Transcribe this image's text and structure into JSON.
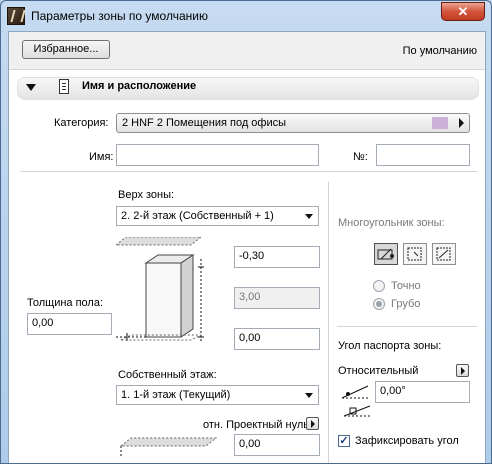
{
  "window": {
    "title": "Параметры зоны по умолчанию",
    "close_label": "✕"
  },
  "topbar": {
    "favorites_label": "Избранное...",
    "default_label": "По умолчанию"
  },
  "section": {
    "title": "Имя и расположение"
  },
  "form": {
    "category_label": "Категория:",
    "category_value": "2 HNF   2 Помещения под офисы",
    "category_color": "#cdb0d8",
    "name_label": "Имя:",
    "name_value": "",
    "number_label": "№:",
    "number_value": ""
  },
  "zone": {
    "top_label": "Верх зоны:",
    "top_value": "2. 2-й этаж (Собственный + 1)",
    "top_offset": "-0,30",
    "height_value": "3,00",
    "bottom_offset": "0,00",
    "floor_thickness_label": "Толщина пола:",
    "floor_thickness_value": "0,00",
    "home_floor_label": "Собственный этаж:",
    "home_floor_value": "1. 1-й этаж (Текущий)",
    "reference_label": "отн. Проектный нуль",
    "reference_value": "0,00"
  },
  "polygon": {
    "label": "Многоугольник зоны:",
    "precise_label": "Точно",
    "gross_label": "Грубо",
    "gross_selected": true
  },
  "stamp": {
    "angle_label": "Угол паспорта зоны:",
    "relative_label": "Относительный",
    "angle_value": "0,00°",
    "fix_angle_label": "Зафиксировать угол",
    "fix_angle_checked": true
  }
}
